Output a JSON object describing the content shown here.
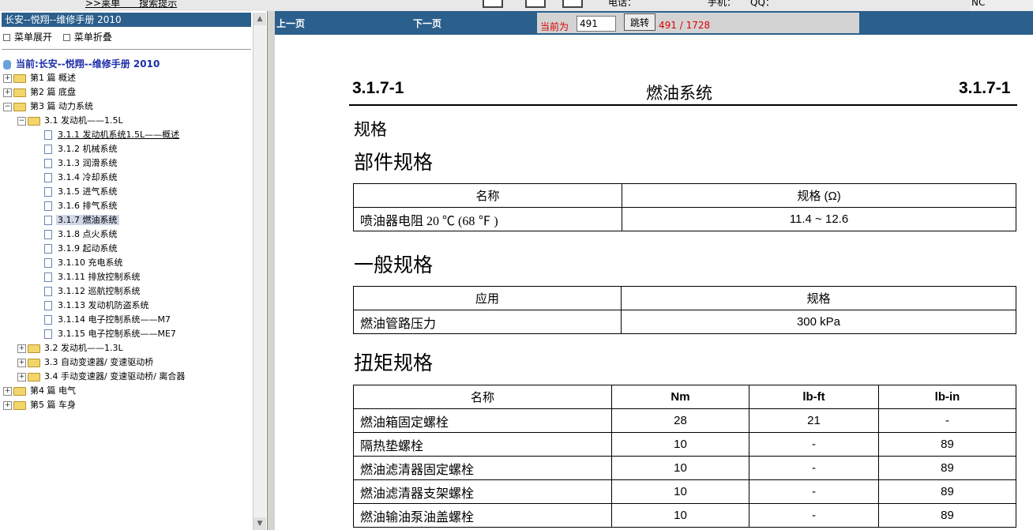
{
  "top": {
    "link": ">>莱单　　搜索提示",
    "text": "电话：　　　　　　　　手机：　　QQ：",
    "corner": "NC"
  },
  "sidebar": {
    "header": "长安--悦翔--维修手册 2010",
    "expand_label": "菜单展开",
    "collapse_label": "菜单折叠",
    "current_label": "当前:长安--悦翔--维修手册 2010",
    "tree": [
      {
        "label": "第1 篇 概述"
      },
      {
        "label": "第2 篇 底盘"
      },
      {
        "label": "第3 篇 动力系统"
      },
      {
        "label": "3.1 发动机——1.5L"
      },
      {
        "label": "3.1.1 发动机系统1.5L——概述"
      },
      {
        "label": "3.1.2 机械系统"
      },
      {
        "label": "3.1.3 润滑系统"
      },
      {
        "label": "3.1.4 冷却系统"
      },
      {
        "label": "3.1.5 进气系统"
      },
      {
        "label": "3.1.6 排气系统"
      },
      {
        "label": "3.1.7 燃油系统"
      },
      {
        "label": "3.1.8 点火系统"
      },
      {
        "label": "3.1.9 起动系统"
      },
      {
        "label": "3.1.10 充电系统"
      },
      {
        "label": "3.1.11 排放控制系统"
      },
      {
        "label": "3.1.12 巡航控制系统"
      },
      {
        "label": "3.1.13 发动机防盗系统"
      },
      {
        "label": "3.1.14 电子控制系统——M7"
      },
      {
        "label": "3.1.15 电子控制系统——ME7"
      },
      {
        "label": "3.2 发动机——1.3L"
      },
      {
        "label": "3.3 自动变速器/ 变速驱动桥"
      },
      {
        "label": "3.4 手动变速器/ 变速驱动桥/ 离合器"
      },
      {
        "label": "第4 篇 电气"
      },
      {
        "label": "第5 篇 车身"
      }
    ]
  },
  "nav": {
    "prev": "上一页",
    "next": "下一页",
    "current_label": "当前为",
    "page_value": "491",
    "jump": "跳转",
    "page_count": "491 / 1728"
  },
  "doc": {
    "header_left": "3.1.7-1",
    "header_center": "燃油系统",
    "header_right": "3.1.7-1",
    "spec_title": "规格",
    "parts_title": "部件规格",
    "parts_table": {
      "headers": [
        "名称",
        "规格 (Ω)"
      ],
      "rows": [
        [
          "喷油器电阻 20 ℃ (68 ℉ )",
          "11.4 ~ 12.6"
        ]
      ]
    },
    "general_title": "一般规格",
    "general_table": {
      "headers": [
        "应用",
        "规格"
      ],
      "rows": [
        [
          "燃油管路压力",
          "300 kPa"
        ]
      ]
    },
    "torque_title": "扭矩规格",
    "torque_table": {
      "headers": [
        "名称",
        "Nm",
        "lb-ft",
        "lb-in"
      ],
      "rows": [
        [
          "燃油箱固定螺栓",
          "28",
          "21",
          "-"
        ],
        [
          "隔热垫螺栓",
          "10",
          "-",
          "89"
        ],
        [
          "燃油滤清器固定螺栓",
          "10",
          "-",
          "89"
        ],
        [
          "燃油滤清器支架螺栓",
          "10",
          "-",
          "89"
        ],
        [
          "燃油输油泵油盖螺栓",
          "10",
          "-",
          "89"
        ]
      ]
    }
  }
}
